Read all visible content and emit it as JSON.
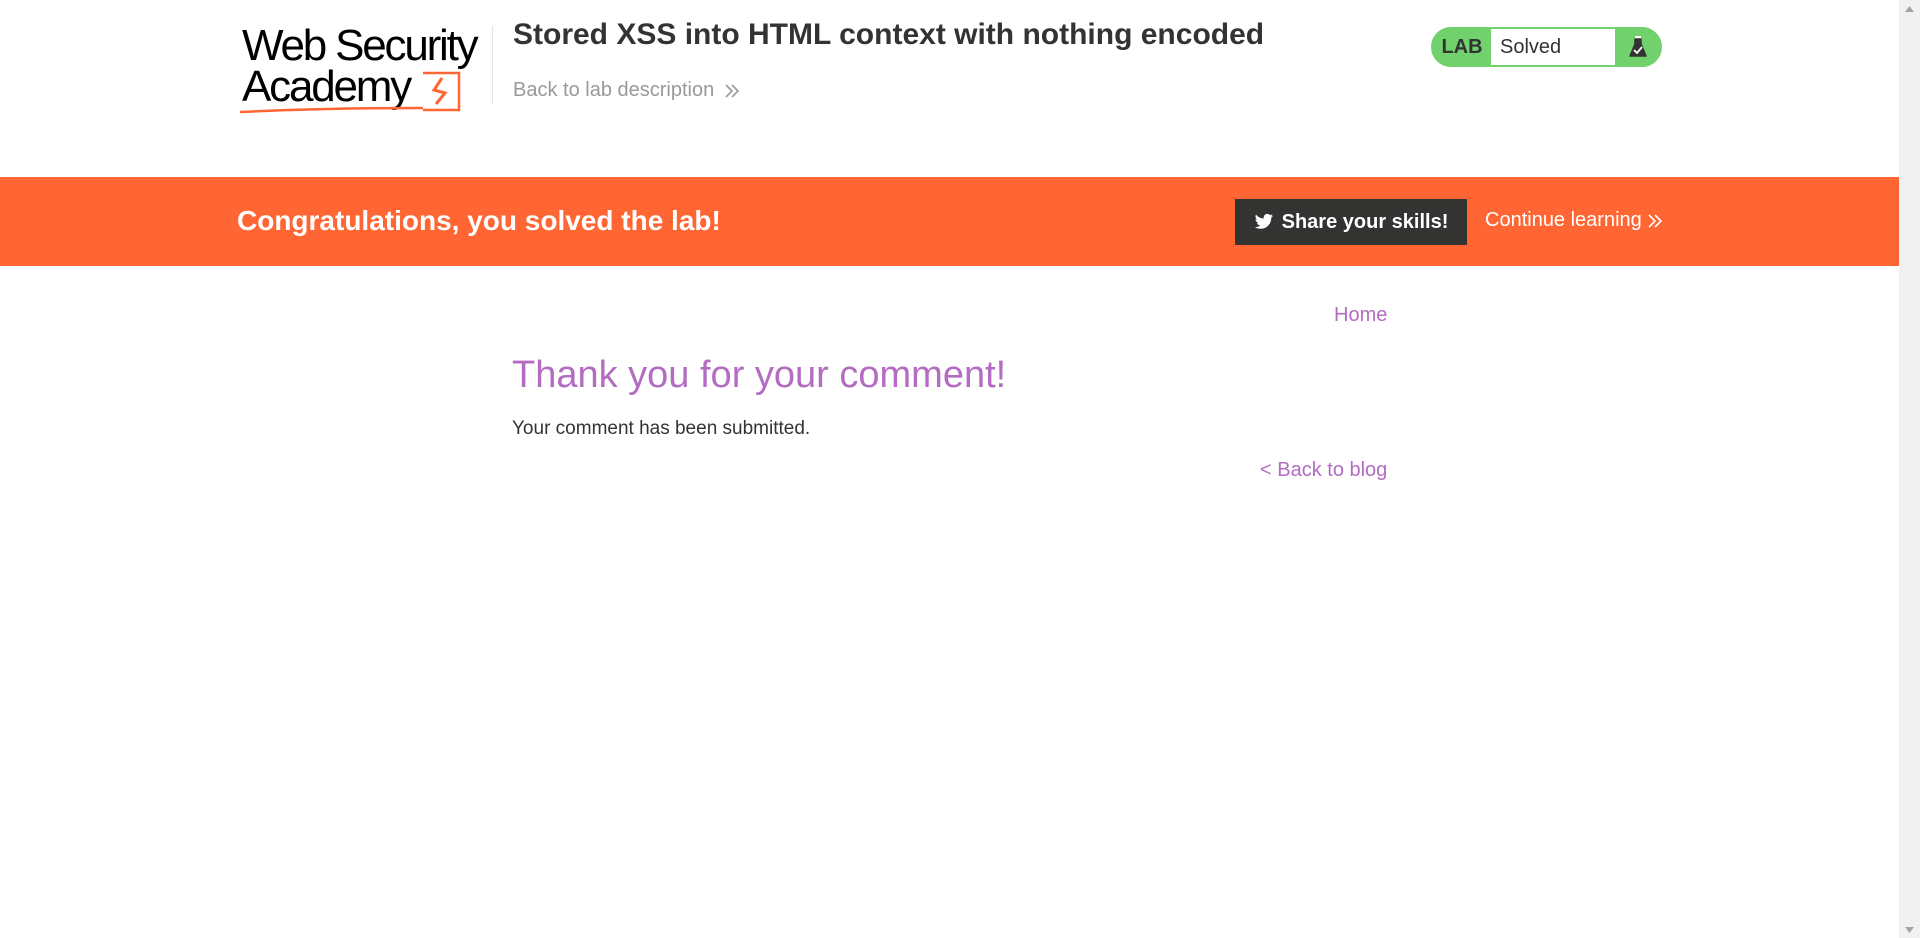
{
  "header": {
    "logo_line1": "Web Security",
    "logo_line2": "Academy",
    "lab_title": "Stored XSS into HTML context with nothing encoded",
    "back_link": "Back to lab description",
    "lab_badge": "LAB",
    "lab_status": "Solved"
  },
  "banner": {
    "message": "Congratulations, you solved the lab!",
    "share_button": "Share your skills!",
    "continue_link": "Continue learning"
  },
  "nav": {
    "home": "Home"
  },
  "main": {
    "heading": "Thank you for your comment!",
    "message": "Your comment has been submitted.",
    "back_to_blog": "< Back to blog"
  },
  "colors": {
    "accent_orange": "#ff6633",
    "link_purple": "#b36cc1",
    "solved_green": "#70d16d",
    "dark": "#333332"
  },
  "icons": {
    "logo": "websecurity-academy-logo",
    "chevrons": "double-chevron-right-icon",
    "flask": "flask-icon",
    "twitter": "twitter-icon"
  }
}
